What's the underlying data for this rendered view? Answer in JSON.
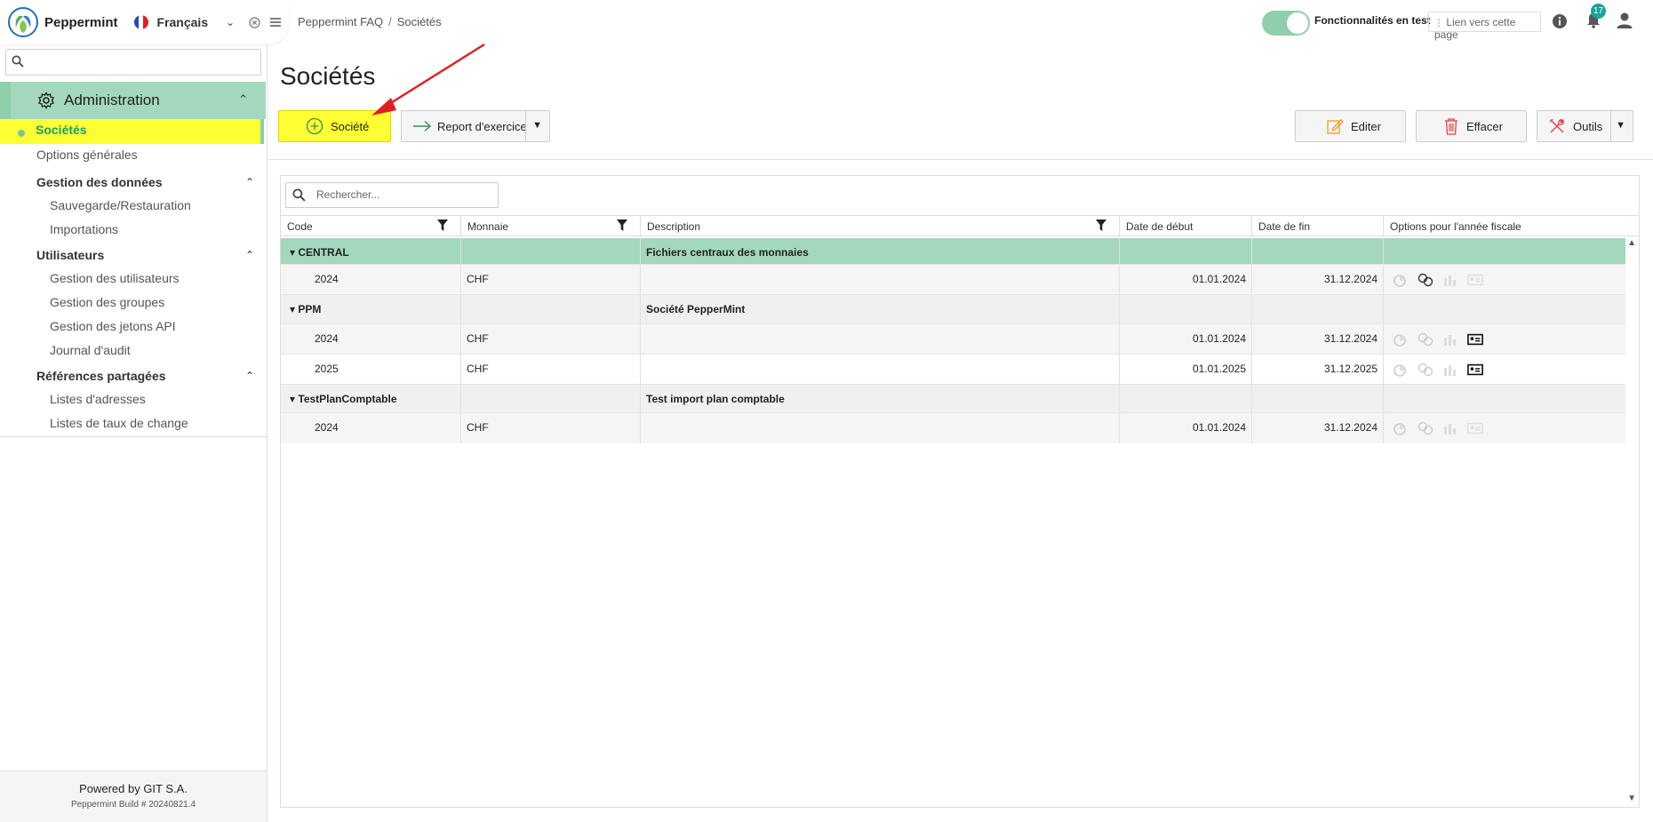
{
  "brand": {
    "name": "Peppermint",
    "language": "Français"
  },
  "sidebar": {
    "search_placeholder": "",
    "section": "Administration",
    "active_item": "Sociétés",
    "items": [
      {
        "label": "Options générales"
      },
      {
        "group": "Gestion des données"
      },
      {
        "label": "Sauvegarde/Restauration"
      },
      {
        "label": "Importations"
      },
      {
        "group": "Utilisateurs"
      },
      {
        "label": "Gestion des utilisateurs"
      },
      {
        "label": "Gestion des groupes"
      },
      {
        "label": "Gestion des jetons API"
      },
      {
        "label": "Journal d'audit"
      },
      {
        "group": "Références partagées"
      },
      {
        "label": "Listes d'adresses"
      },
      {
        "label": "Listes de taux de change"
      }
    ],
    "footer": {
      "powered": "Powered by GIT S.A.",
      "build": "Peppermint Build # 20240821.4"
    }
  },
  "topbar": {
    "breadcrumb": [
      "Peppermint FAQ",
      "Sociétés"
    ],
    "features_label": "Fonctionnalités en test",
    "features_on": true,
    "link_label": "Lien vers cette page",
    "notification_count": "17"
  },
  "page": {
    "title": "Sociétés",
    "buttons": {
      "add": "Société",
      "report": "Report d'exercice",
      "edit": "Editer",
      "delete": "Effacer",
      "tools": "Outils"
    }
  },
  "grid": {
    "search_placeholder": "Rechercher...",
    "columns": [
      "Code",
      "Monnaie",
      "Description",
      "Date de début",
      "Date de fin",
      "Options pour l'année fiscale"
    ],
    "groups": [
      {
        "code": "CENTRAL",
        "description": "Fichiers centraux des monnaies",
        "rows": [
          {
            "code": "2024",
            "currency": "CHF",
            "start": "01.01.2024",
            "end": "31.12.2024"
          }
        ]
      },
      {
        "code": "PPM",
        "description": "Société PepperMint",
        "rows": [
          {
            "code": "2024",
            "currency": "CHF",
            "start": "01.01.2024",
            "end": "31.12.2024"
          },
          {
            "code": "2025",
            "currency": "CHF",
            "start": "01.01.2025",
            "end": "31.12.2025"
          }
        ]
      },
      {
        "code": "TestPlanComptable",
        "description": "Test import plan comptable",
        "rows": [
          {
            "code": "2024",
            "currency": "CHF",
            "start": "01.01.2024",
            "end": "31.12.2024"
          }
        ]
      }
    ]
  },
  "colors": {
    "accent_green": "#a3d8bd",
    "highlight_yellow": "#ffff33",
    "active_text": "#1a9e6a",
    "annotation_red": "#e02020"
  }
}
